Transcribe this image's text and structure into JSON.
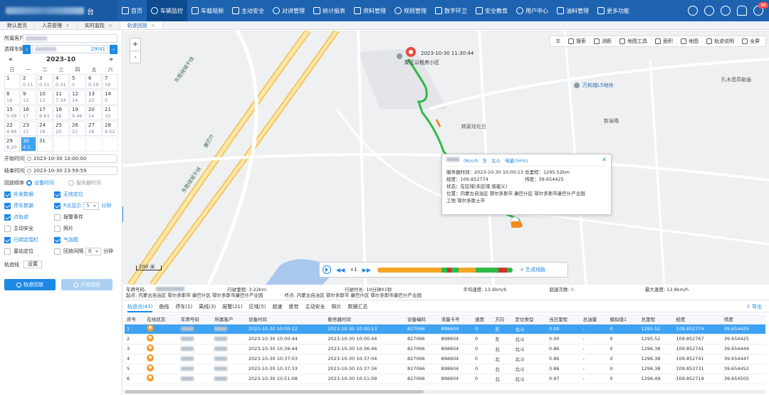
{
  "nav": [
    "首页",
    "车辆监控",
    "车载视频",
    "主动安全",
    "对讲管理",
    "统计报表",
    "资料管理",
    "规则管理",
    "数字环卫",
    "安全教育",
    "用户中心",
    "油料管理",
    "更多功能"
  ],
  "nav_active": 1,
  "notif_badge": "96",
  "tabs": [
    "默认首页",
    "人员管理",
    "实时监控",
    "轨迹回放"
  ],
  "active_tab": 3,
  "left": {
    "customer_label": "所属客户",
    "vehicle_label": "选择车辆",
    "vehicle_count": "29/41",
    "month": "2023-10",
    "weekdays": [
      "日",
      "一",
      "二",
      "三",
      "四",
      "五",
      "六"
    ],
    "days": [
      {
        "d": "1",
        "m": ""
      },
      {
        "d": "2",
        "m": "0.11"
      },
      {
        "d": "3",
        "m": "0.11"
      },
      {
        "d": "4",
        "m": "0.31"
      },
      {
        "d": "5",
        "m": "0"
      },
      {
        "d": "6",
        "m": "0.19"
      },
      {
        "d": "7",
        "m": "16"
      },
      {
        "d": "8",
        "m": "19"
      },
      {
        "d": "9",
        "m": "13"
      },
      {
        "d": "10",
        "m": "13"
      },
      {
        "d": "11",
        "m": "7.34"
      },
      {
        "d": "12",
        "m": "14"
      },
      {
        "d": "13",
        "m": "20"
      },
      {
        "d": "14",
        "m": "0"
      },
      {
        "d": "15",
        "m": "0.08"
      },
      {
        "d": "16",
        "m": "17"
      },
      {
        "d": "17",
        "m": "8.63"
      },
      {
        "d": "18",
        "m": "18"
      },
      {
        "d": "19",
        "m": "9.46"
      },
      {
        "d": "20",
        "m": "14"
      },
      {
        "d": "21",
        "m": "10"
      },
      {
        "d": "22",
        "m": "4.66"
      },
      {
        "d": "23",
        "m": "15"
      },
      {
        "d": "24",
        "m": "18"
      },
      {
        "d": "25",
        "m": "20"
      },
      {
        "d": "26",
        "m": "22"
      },
      {
        "d": "27",
        "m": "18"
      },
      {
        "d": "28",
        "m": "9.52"
      },
      {
        "d": "29",
        "m": "8.20"
      },
      {
        "d": "30",
        "m": "4.3"
      },
      {
        "d": "31",
        "m": ""
      }
    ],
    "selected_day": "30",
    "start_label": "开始时间",
    "start_value": "2023-10-30 10:00:00",
    "end_label": "结束时间",
    "end_value": "2023-10-30 23:59:59",
    "order_label": "回放顺序",
    "order_device": "设备时间",
    "order_server": "服务器时间",
    "checks": [
      {
        "label": "补发数据",
        "on": true
      },
      {
        "label": "无效定位",
        "on": true
      },
      {
        "label": "停车数据",
        "on": true
      },
      {
        "label": "P点显示",
        "on": true
      },
      {
        "label": "点轨迹",
        "on": true
      },
      {
        "label": "报警事件",
        "on": false
      },
      {
        "label": "主动安全",
        "on": false
      },
      {
        "label": "照片",
        "on": false
      },
      {
        "label": "已绑定围栏",
        "on": true
      },
      {
        "label": "气泡框",
        "on": true
      },
      {
        "label": "基站定位",
        "on": false
      },
      {
        "label": "回放间隔",
        "on": false
      }
    ],
    "p_display_value": "5",
    "interval_value": "0",
    "unit_min": "分钟",
    "track_line_label": "轨迹线",
    "settings_btn": "设置",
    "start_btn": "轨迹回放",
    "begin_btn": "开始回放"
  },
  "map": {
    "tools": [
      "搜索",
      "测距",
      "地图工具",
      "面积",
      "地图",
      "轨迹说明",
      "全屏"
    ],
    "labels": [
      "东胜绕城干线",
      "东胜绕城干线",
      "康巴什",
      "万和城L5地块",
      "新庙壕",
      "扎木音高勒庙",
      "韩家坟圪旦"
    ],
    "start_time": "2023-10-30 11:30:44",
    "start_place": "聚区公租房小区",
    "scale": "200 米",
    "popup": {
      "speed": "0km/h",
      "dir": "东",
      "loc_type": "北斗",
      "power": "电量(56%)",
      "server_time": "服务器时间：2023-10-30 10:00:13",
      "total": "总里程：1295.52km",
      "lng": "经度：109.852774",
      "lat": "纬度：39.654425",
      "status": "状态：在区域(未区域:谱建义)",
      "pos": "位置：内蒙古自治区 鄂尔多斯市 康巴什区 鄂尔多斯市康巴什产业园",
      "extra": "工地 鄂尔多斯土市"
    },
    "player": {
      "speed": "×1",
      "add": "生成线路"
    }
  },
  "summary": {
    "plate": "车牌号码:",
    "mileage": "行驶里程: 3.22km",
    "duration": "行驶时长: 10分钟01秒",
    "avg": "平均速度: 13.9km/h",
    "over": "超速次数:",
    "over_val": "0",
    "max": "最大速度: 13.9km/h",
    "start": "起点: 内蒙古自治区 鄂尔多斯市 康巴什区 鄂尔多斯市康巴什产业园",
    "end": "终点: 内蒙古自治区 鄂尔多斯市 康巴什区 鄂尔多斯市康巴什产业园"
  },
  "table_tabs": [
    "轨迹点(43)",
    "曲线",
    "停车(1)",
    "离线(3)",
    "报警(21)",
    "区域(5)",
    "超速",
    "疲劳",
    "主动安全",
    "照片",
    "数据汇总"
  ],
  "export_label": "导出",
  "columns": [
    "序号",
    "在线状态",
    "车牌号码",
    "所属客户",
    "设备时间",
    "服务器时间",
    "设备编码",
    "流量卡号",
    "速度",
    "方向",
    "定位类型",
    "当日里程",
    "总油量",
    "模拟值1",
    "总里程",
    "经度",
    "纬度"
  ],
  "rows": [
    [
      "1",
      "2023-10-30 10:00:12",
      "2023-10-30 10:00:13",
      "827066",
      "898604",
      "0",
      "东",
      "北斗",
      "0.00",
      "-",
      "0",
      "1295.52",
      "109.852774",
      "39.654425"
    ],
    [
      "2",
      "2023-10-30 10:00:44",
      "2023-10-30 10:00:44",
      "827066",
      "898604",
      "0",
      "东",
      "北斗",
      "0.00",
      "-",
      "0",
      "1295.52",
      "109.852767",
      "39.654425"
    ],
    [
      "3",
      "2023-10-30 10:36:44",
      "2023-10-30 10:36:46",
      "827066",
      "898604",
      "0",
      "北",
      "北斗",
      "0.86",
      "-",
      "0",
      "1296.38",
      "109.852741",
      "39.654444"
    ],
    [
      "4",
      "2023-10-30 10:37:03",
      "2023-10-30 10:37:04",
      "827066",
      "898604",
      "0",
      "北",
      "北斗",
      "0.86",
      "-",
      "0",
      "1296.38",
      "109.852741",
      "39.654447"
    ],
    [
      "5",
      "2023-10-30 10:37:33",
      "2023-10-30 10:37:34",
      "827066",
      "898604",
      "0",
      "北",
      "北斗",
      "0.86",
      "-",
      "0",
      "1296.38",
      "109.852731",
      "39.654452"
    ],
    [
      "6",
      "2023-10-30 10:51:08",
      "2023-10-30 10:51:09",
      "827066",
      "898604",
      "0",
      "北",
      "北斗",
      "0.97",
      "-",
      "0",
      "1296.49",
      "109.852719",
      "39.654505"
    ]
  ]
}
